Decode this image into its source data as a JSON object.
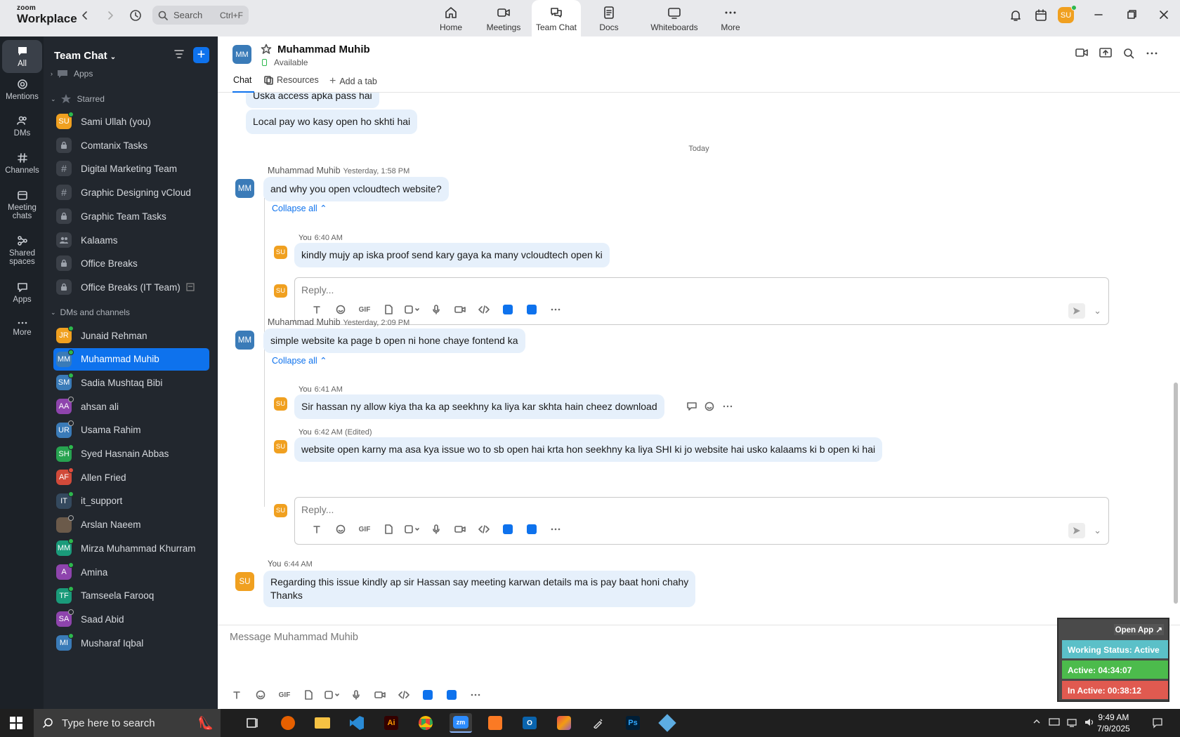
{
  "app": {
    "logo_small": "zoom",
    "logo_big": "Workplace"
  },
  "search": {
    "placeholder": "Search",
    "shortcut": "Ctrl+F"
  },
  "tabs": [
    {
      "label": "Home",
      "icon": "home-icon"
    },
    {
      "label": "Meetings",
      "icon": "video-icon"
    },
    {
      "label": "Team Chat",
      "icon": "chat-icon",
      "active": true
    },
    {
      "label": "Docs",
      "icon": "docs-icon"
    },
    {
      "label": "Whiteboards",
      "icon": "whiteboard-icon"
    },
    {
      "label": "More",
      "icon": "more-icon"
    }
  ],
  "user": {
    "initials": "SU",
    "avatar_color": "#f0a020"
  },
  "rail": [
    {
      "label": "All",
      "active": true
    },
    {
      "label": "Mentions"
    },
    {
      "label": "DMs"
    },
    {
      "label": "Channels"
    },
    {
      "label": "Meeting chats"
    },
    {
      "label": "Shared spaces"
    },
    {
      "label": "Apps"
    },
    {
      "label": "More"
    }
  ],
  "sidebar": {
    "title": "Team Chat",
    "sections": {
      "apps": "Apps",
      "starred": "Starred",
      "dms": "DMs and channels"
    },
    "starred": [
      {
        "label": "Sami Ullah (you)",
        "initials": "SU",
        "color": "#f0a020",
        "type": "user"
      },
      {
        "label": "Comtanix Tasks",
        "type": "lock"
      },
      {
        "label": "Digital Marketing Team",
        "type": "hash"
      },
      {
        "label": "Graphic Designing vCloud",
        "type": "hash"
      },
      {
        "label": "Graphic Team Tasks",
        "type": "lock"
      },
      {
        "label": "Kalaams",
        "type": "group"
      },
      {
        "label": "Office Breaks",
        "type": "lock"
      },
      {
        "label": "Office Breaks (IT Team)",
        "type": "lock"
      }
    ],
    "dms": [
      {
        "label": "Junaid Rehman",
        "initials": "JR",
        "color": "#f0a020"
      },
      {
        "label": "Muhammad Muhib",
        "initials": "MM",
        "color": "#3a7bb8",
        "selected": true
      },
      {
        "label": "Sadia Mushtaq Bibi",
        "initials": "SM",
        "color": "#3a7bb8"
      },
      {
        "label": "ahsan ali",
        "initials": "AA",
        "color": "#8e44ad"
      },
      {
        "label": "Usama Rahim",
        "initials": "UR",
        "color": "#3a7bb8"
      },
      {
        "label": "Syed Hasnain Abbas",
        "initials": "SH",
        "color": "#27a350"
      },
      {
        "label": "Allen Fried",
        "initials": "AF",
        "color": "#d14a3a"
      },
      {
        "label": "it_support",
        "initials": "IT",
        "color": "#34495e"
      },
      {
        "label": "Arslan Naeem",
        "initials": "",
        "color": "#6b5a4a"
      },
      {
        "label": "Mirza Muhammad Khurram",
        "initials": "MM",
        "color": "#1a9b7a"
      },
      {
        "label": "Amina",
        "initials": "A",
        "color": "#8e44ad"
      },
      {
        "label": "Tamseela Farooq",
        "initials": "TF",
        "color": "#1a9b7a"
      },
      {
        "label": "Saad Abid",
        "initials": "SA",
        "color": "#8e44ad"
      },
      {
        "label": "Musharaf Iqbal",
        "initials": "MI",
        "color": "#3a7bb8"
      }
    ]
  },
  "chat": {
    "contact": "Muhammad Muhib",
    "initials": "MM",
    "status": "Available",
    "tabs": [
      "Chat",
      "Resources",
      "Add a tab"
    ],
    "date_divider": "Today",
    "messages": {
      "m0": "Uska access apka pass hai",
      "m1": "Local pay wo kasy open ho skhti hai",
      "m2_sender": "Muhammad Muhib",
      "m2_time": "Yesterday, 1:58 PM",
      "m2": "and why you open vcloudtech website?",
      "collapse": "Collapse all",
      "r1_sender": "You",
      "r1_time": "6:40 AM",
      "r1": "kindly mujy ap iska proof send kary gaya ka many vcloudtech open ki",
      "reply_placeholder": "Reply...",
      "m3_sender": "Muhammad Muhib",
      "m3_time": "Yesterday, 2:09 PM",
      "m3": "simple website ka page b open ni hone chaye fontend ka",
      "r2_sender": "You",
      "r2_time": "6:41 AM",
      "r2": "Sir hassan ny allow kiya tha ka ap seekhny ka liya kar skhta hain cheez download",
      "r3_sender": "You",
      "r3_time": "6:42 AM (Edited)",
      "r3": "website open karny ma asa kya issue wo to sb open hai krta hon seekhny ka liya SHI ki jo website hai usko kalaams ki b open ki hai",
      "m4_sender": "You",
      "m4_time": "6:44 AM",
      "m4_line1": "Regarding this issue kindly ap sir Hassan say meeting karwan details ma is pay baat honi chahy",
      "m4_line2": "Thanks"
    },
    "composer_placeholder": "Message Muhammad Muhib"
  },
  "widget": {
    "open_app": "Open App ↗",
    "working_status": "Working Status: Active",
    "active": "Active: 04:34:07",
    "inactive": "In Active: 00:38:12",
    "colors": {
      "status": "#5bc0c8",
      "active": "#4cbb4c",
      "inactive": "#e05a50"
    }
  },
  "taskbar": {
    "search_placeholder": "Type here to search",
    "time": "9:49 AM",
    "date": "7/9/2025"
  }
}
